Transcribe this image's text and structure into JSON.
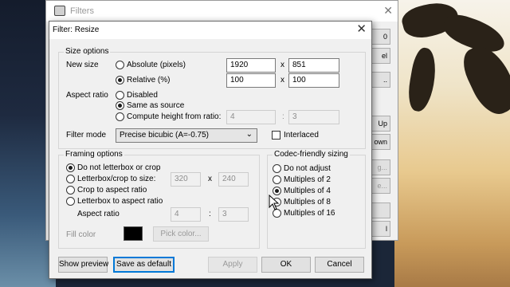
{
  "parent_window": {
    "title": "Filters",
    "right_buttons": [
      "0",
      "el",
      "..",
      "Up",
      "own",
      "g...",
      "e...",
      "",
      "l"
    ]
  },
  "dialog": {
    "title": "Filter: Resize",
    "size_options": {
      "group_title": "Size options",
      "new_size_label": "New size",
      "absolute_label": "Absolute (pixels)",
      "absolute_selected": false,
      "absolute_width": "1920",
      "absolute_height": "851",
      "relative_label": "Relative (%)",
      "relative_selected": true,
      "relative_width": "100",
      "relative_height": "100",
      "x_sep": "x",
      "aspect_ratio_label": "Aspect ratio",
      "disabled_label": "Disabled",
      "same_as_source_label": "Same as source",
      "compute_label": "Compute height from ratio:",
      "compute_a": "4",
      "compute_b": "3",
      "colon_sep": ":",
      "filter_mode_label": "Filter mode",
      "filter_mode_value": "Precise bicubic (A=-0.75)",
      "interlaced_label": "Interlaced",
      "interlaced_checked": false
    },
    "framing_options": {
      "group_title": "Framing options",
      "do_not_label": "Do not letterbox or crop",
      "letterbox_crop_label": "Letterbox/crop to size:",
      "letterbox_w": "320",
      "letterbox_h": "240",
      "crop_aspect_label": "Crop to aspect ratio",
      "letterbox_aspect_label": "Letterbox to aspect ratio",
      "aspect_ratio_label": "Aspect ratio",
      "aspect_a": "4",
      "aspect_b": "3",
      "fill_color_label": "Fill color",
      "fill_color": "#000000",
      "pick_color_label": "Pick color..."
    },
    "codec_sizing": {
      "group_title": "Codec-friendly sizing",
      "options": [
        "Do not adjust",
        "Multiples of 2",
        "Multiples of 4",
        "Multiples of 8",
        "Multiples of 16"
      ],
      "selected_index": 2
    },
    "buttons": {
      "show_preview": "Show preview",
      "save_default": "Save as default",
      "apply": "Apply",
      "ok": "OK",
      "cancel": "Cancel"
    }
  },
  "colors": {
    "accent": "#0078d7",
    "dialog_bg": "#f0f0f0"
  }
}
